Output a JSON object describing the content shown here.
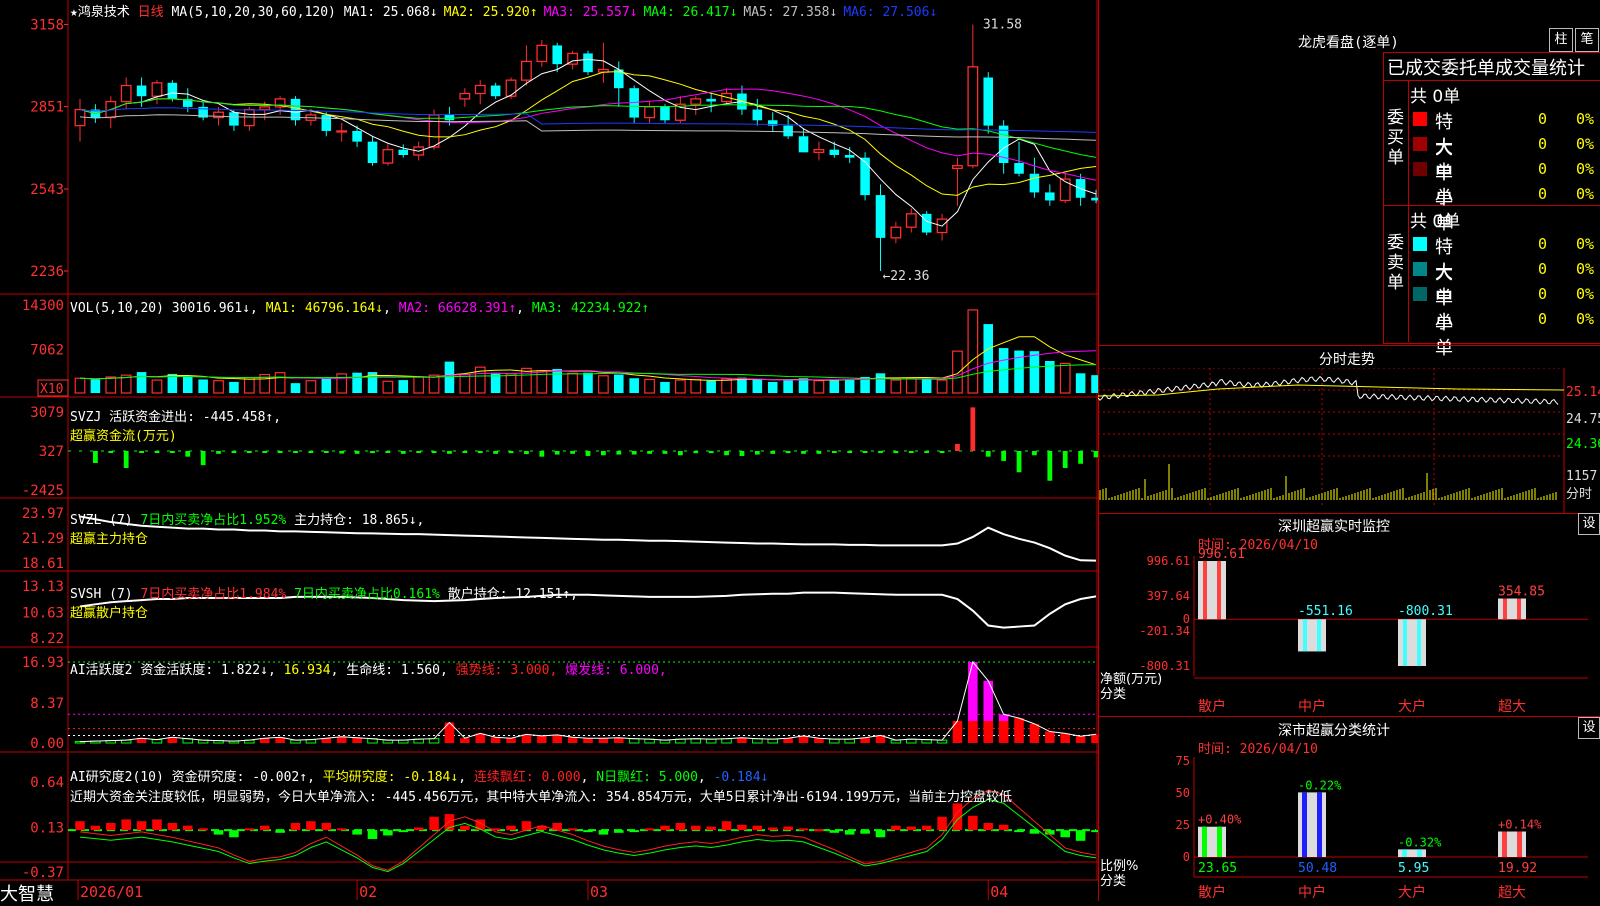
{
  "colors": {
    "up": "#ff2d2d",
    "down": "#00ffff",
    "ma1": "#ffffff",
    "ma2": "#ffff00",
    "ma3": "#ff00ff",
    "ma4": "#00ff00",
    "ma5": "#c0c0c0",
    "ma6": "#1a3cff",
    "grid": "#c00000",
    "axis": "#ff3030"
  },
  "app": {
    "logo": "大智慧"
  },
  "kline": {
    "stock_name": "鸿泉技术",
    "period": "日线",
    "ma_params": "MA(5,10,20,30,60,120)",
    "ma_labels": [
      {
        "text": "MA1: 25.068↓",
        "color": "#ffffff"
      },
      {
        "text": "MA2: 25.920↑",
        "color": "#ffff00"
      },
      {
        "text": "MA3: 25.557↓",
        "color": "#ff00ff"
      },
      {
        "text": "MA4: 26.417↓",
        "color": "#00ff00"
      },
      {
        "text": "MA5: 27.358↓",
        "color": "#c0c0c0"
      },
      {
        "text": "MA6: 27.506↓",
        "color": "#1a3cff"
      }
    ],
    "y_ticks": [
      "3158",
      "2851",
      "2543",
      "2236"
    ],
    "high_label": "31.58",
    "low_label": "←22.36",
    "candles": [
      [
        27.8,
        28.8,
        27.2,
        28.4
      ],
      [
        28.4,
        28.6,
        27.9,
        28.1
      ],
      [
        28.1,
        28.9,
        27.7,
        28.7
      ],
      [
        28.7,
        29.6,
        28.4,
        29.3
      ],
      [
        29.3,
        29.6,
        28.5,
        28.9
      ],
      [
        28.9,
        29.5,
        28.6,
        29.4
      ],
      [
        29.4,
        29.5,
        28.7,
        28.8
      ],
      [
        28.8,
        29.2,
        28.3,
        28.5
      ],
      [
        28.5,
        28.7,
        28.0,
        28.1
      ],
      [
        28.1,
        28.5,
        27.8,
        28.3
      ],
      [
        28.3,
        28.4,
        27.6,
        27.8
      ],
      [
        27.8,
        28.5,
        27.6,
        28.4
      ],
      [
        28.4,
        28.7,
        28.0,
        28.5
      ],
      [
        28.5,
        28.9,
        28.2,
        28.8
      ],
      [
        28.8,
        28.9,
        27.8,
        28.0
      ],
      [
        28.0,
        28.3,
        27.8,
        28.2
      ],
      [
        28.2,
        28.3,
        27.4,
        27.6
      ],
      [
        27.6,
        27.9,
        27.2,
        27.6
      ],
      [
        27.6,
        27.8,
        27.0,
        27.2
      ],
      [
        27.2,
        27.4,
        26.3,
        26.4
      ],
      [
        26.4,
        27.1,
        26.3,
        26.9
      ],
      [
        26.9,
        27.1,
        26.6,
        26.7
      ],
      [
        26.7,
        27.2,
        26.5,
        27.0
      ],
      [
        27.0,
        28.4,
        26.9,
        28.2
      ],
      [
        28.2,
        28.5,
        27.8,
        28.0
      ],
      [
        28.8,
        29.2,
        28.5,
        29.0
      ],
      [
        29.0,
        29.5,
        28.6,
        29.3
      ],
      [
        29.3,
        29.4,
        28.8,
        28.9
      ],
      [
        28.9,
        29.6,
        28.8,
        29.5
      ],
      [
        29.5,
        30.8,
        29.3,
        30.2
      ],
      [
        30.2,
        31.0,
        30.0,
        30.8
      ],
      [
        30.8,
        30.9,
        29.8,
        30.1
      ],
      [
        30.1,
        30.6,
        29.9,
        30.5
      ],
      [
        30.5,
        30.6,
        29.7,
        29.8
      ],
      [
        29.8,
        30.9,
        29.4,
        29.9
      ],
      [
        29.9,
        30.2,
        28.5,
        29.2
      ],
      [
        29.2,
        29.3,
        27.9,
        28.1
      ],
      [
        28.1,
        28.7,
        27.9,
        28.5
      ],
      [
        28.5,
        28.6,
        27.9,
        28.0
      ],
      [
        28.0,
        28.9,
        27.9,
        28.6
      ],
      [
        28.6,
        28.9,
        28.2,
        28.8
      ],
      [
        28.8,
        29.0,
        28.3,
        28.7
      ],
      [
        28.7,
        29.2,
        28.6,
        29.0
      ],
      [
        29.0,
        29.3,
        28.2,
        28.4
      ],
      [
        28.4,
        28.8,
        27.8,
        28.0
      ],
      [
        28.0,
        28.3,
        27.6,
        27.8
      ],
      [
        27.8,
        28.2,
        27.3,
        27.4
      ],
      [
        27.4,
        27.7,
        26.8,
        26.8
      ],
      [
        26.8,
        27.2,
        26.5,
        26.9
      ],
      [
        26.9,
        27.2,
        26.6,
        26.7
      ],
      [
        26.7,
        27.0,
        26.4,
        26.6
      ],
      [
        26.6,
        26.8,
        25.0,
        25.2
      ],
      [
        25.2,
        25.6,
        22.36,
        23.6
      ],
      [
        23.6,
        24.2,
        23.4,
        24.0
      ],
      [
        24.0,
        24.7,
        23.8,
        24.5
      ],
      [
        24.5,
        24.6,
        23.7,
        23.8
      ],
      [
        23.8,
        24.5,
        23.5,
        24.3
      ],
      [
        26.2,
        26.6,
        24.8,
        26.3
      ],
      [
        26.3,
        31.58,
        26.2,
        30.0
      ],
      [
        29.6,
        29.8,
        27.5,
        27.8
      ],
      [
        27.8,
        28.0,
        26.0,
        26.4
      ],
      [
        26.4,
        27.2,
        25.9,
        26.0
      ],
      [
        26.0,
        26.6,
        25.1,
        25.3
      ],
      [
        25.3,
        25.6,
        24.8,
        25.0
      ],
      [
        25.0,
        26.0,
        24.9,
        25.8
      ],
      [
        25.8,
        26.0,
        24.8,
        25.1
      ],
      [
        25.1,
        25.4,
        24.9,
        25.0
      ]
    ]
  },
  "vol": {
    "title": "VOL(5,10,20)",
    "value": "30016.961↓",
    "ma1": "MA1: 46796.164↓",
    "ma2": "MA2: 66628.391↑",
    "ma3": "MA3: 42234.922↑",
    "y_ticks": [
      "14300",
      "7062"
    ],
    "unit": "X10",
    "values": [
      2.4,
      2.2,
      2.6,
      2.9,
      3.4,
      2.1,
      3.1,
      2.7,
      2.2,
      2.0,
      1.8,
      2.5,
      3.0,
      3.3,
      1.6,
      2.0,
      2.5,
      3.1,
      3.3,
      3.4,
      1.9,
      2.1,
      2.6,
      2.9,
      5.1,
      3.0,
      4.2,
      3.3,
      3.1,
      4.0,
      3.6,
      3.9,
      3.2,
      3.3,
      2.8,
      3.0,
      2.4,
      2.2,
      1.8,
      2.1,
      2.2,
      2.0,
      2.3,
      2.5,
      2.2,
      1.8,
      2.1,
      2.4,
      2.0,
      2.2,
      2.2,
      2.6,
      3.2,
      2.1,
      2.4,
      2.3,
      2.1,
      6.8,
      13.5,
      11.2,
      7.3,
      6.9,
      6.8,
      5.2,
      4.8,
      3.2,
      2.9
    ]
  },
  "svzj": {
    "title": "SVZJ",
    "desc": "活跃资金进出: -445.458↑,",
    "sub": "超赢资金流(万元)",
    "y_ticks": [
      "3079",
      "327",
      "-2425"
    ],
    "values": [
      0,
      -850,
      -20,
      -1200,
      -40,
      -20,
      -90,
      -400,
      -1000,
      -200,
      -120,
      -100,
      -120,
      -20,
      -130,
      -80,
      -90,
      -180,
      -200,
      -150,
      -120,
      -200,
      -100,
      -120,
      -200,
      -130,
      -40,
      -200,
      -150,
      -220,
      -400,
      -250,
      -200,
      -350,
      -300,
      -250,
      -250,
      -200,
      -200,
      -300,
      -150,
      -150,
      -300,
      -350,
      -250,
      -200,
      -150,
      -200,
      -200,
      -120,
      -100,
      -120,
      -120,
      -150,
      -130,
      -80,
      -100,
      500,
      3079,
      -400,
      -700,
      -1500,
      -300,
      -2100,
      -1200,
      -900,
      -445
    ]
  },
  "svzl": {
    "title": "SVZL (7)",
    "desc1": "7日内买卖净占比1.952%",
    "desc2": "主力持仓: 18.865↓,",
    "sub": "超赢主力持仓",
    "y_ticks": [
      "23.97",
      "21.29",
      "18.61"
    ],
    "values": [
      23.6,
      23.3,
      23.0,
      22.8,
      22.6,
      22.5,
      22.4,
      22.3,
      22.3,
      22.2,
      22.2,
      22.1,
      22.1,
      22.0,
      22.0,
      21.95,
      21.9,
      21.85,
      21.8,
      21.78,
      21.75,
      21.7,
      21.7,
      21.65,
      21.6,
      21.55,
      21.5,
      21.45,
      21.4,
      21.35,
      21.3,
      21.25,
      21.2,
      21.15,
      21.1,
      21.1,
      21.05,
      21.0,
      21.0,
      20.95,
      20.9,
      20.85,
      20.8,
      20.75,
      20.7,
      20.7,
      20.65,
      20.6,
      20.6,
      20.6,
      20.55,
      20.55,
      20.5,
      20.5,
      20.5,
      20.5,
      20.5,
      20.7,
      21.4,
      22.4,
      21.7,
      21.2,
      20.8,
      20.2,
      19.4,
      18.9,
      18.86
    ]
  },
  "svsh": {
    "title": "SVSH (7)",
    "desc1": "7日内买卖净占比1.984%",
    "desc2": "7日内买卖净占比0.161%",
    "desc3": "散户持仓: 12.151↑,",
    "sub": "超赢散户持仓",
    "y_ticks": [
      "13.13",
      "10.63",
      "8.22"
    ],
    "values": [
      11.2,
      11.4,
      11.6,
      11.7,
      11.8,
      11.9,
      11.9,
      12.0,
      12.0,
      12.0,
      12.0,
      12.0,
      12.0,
      12.0,
      12.1,
      12.1,
      12.1,
      12.1,
      12.05,
      12.0,
      11.9,
      11.8,
      11.75,
      11.7,
      11.75,
      11.8,
      11.9,
      12.0,
      12.05,
      12.1,
      12.2,
      12.3,
      12.3,
      12.3,
      12.25,
      12.2,
      12.15,
      12.1,
      12.1,
      12.1,
      12.1,
      12.15,
      12.2,
      12.3,
      12.35,
      12.4,
      12.4,
      12.5,
      12.5,
      12.5,
      12.45,
      12.4,
      12.35,
      12.3,
      12.3,
      12.3,
      12.3,
      11.9,
      10.8,
      9.4,
      9.2,
      9.3,
      9.4,
      10.5,
      11.4,
      11.9,
      12.15
    ]
  },
  "ai": {
    "title": "AI活跃度2",
    "desc1": "资金活跃度: 1.822↓",
    "desc2": "16.934",
    "desc3": "生命线: 1.560,",
    "desc4": "强势线: 3.000,",
    "desc5": "爆发线: 6.000,",
    "y_ticks": [
      "16.93",
      "8.37",
      "0.00"
    ],
    "values": [
      0.3,
      0.4,
      0.5,
      0.6,
      1.0,
      0.7,
      1.2,
      0.9,
      0.6,
      0.5,
      0.4,
      0.6,
      1.0,
      1.2,
      0.6,
      0.7,
      1.0,
      1.3,
      1.1,
      0.9,
      0.6,
      0.6,
      0.8,
      0.9,
      4.3,
      1.0,
      2.0,
      1.2,
      1.0,
      1.8,
      1.5,
      1.7,
      1.2,
      1.0,
      1.0,
      1.1,
      0.9,
      0.8,
      0.6,
      0.8,
      0.9,
      0.8,
      0.9,
      1.1,
      0.9,
      0.8,
      1.0,
      1.5,
      1.0,
      0.8,
      0.8,
      1.1,
      1.6,
      0.6,
      0.8,
      0.7,
      0.6,
      4.6,
      16.93,
      13.0,
      6.0,
      5.2,
      4.0,
      2.4,
      2.0,
      1.4,
      1.822
    ]
  },
  "ai2": {
    "title": "AI研究度2(10)",
    "desc1": "资金研究度: -0.002↑",
    "desc2": "平均研究度: -0.184↓",
    "desc3": "连续飘红: 0.000",
    "desc4": "N日飘红: 5.000",
    "desc5": "-0.184↓",
    "note": "近期大资金关注度较低，明显弱势，今日大单净流入: -445.456万元，其中特大单净流入: 354.854万元，大单5日累计净出-6194.199万元，当前主力控盘较低",
    "y_ticks": [
      "0.64",
      "0.13",
      "-0.37"
    ],
    "values": [
      0.1,
      0.05,
      0.08,
      0.12,
      0.1,
      0.12,
      0.08,
      0.05,
      0.02,
      -0.05,
      -0.08,
      0.02,
      0.05,
      -0.03,
      0.08,
      0.1,
      0.08,
      0.02,
      -0.05,
      -0.1,
      -0.06,
      -0.02,
      0.03,
      0.15,
      0.18,
      0.05,
      0.12,
      0.02,
      0.05,
      0.1,
      0.05,
      0.08,
      0.02,
      -0.02,
      -0.05,
      -0.03,
      -0.02,
      0.02,
      0.05,
      0.08,
      0.05,
      0.04,
      0.1,
      0.06,
      0.05,
      0.03,
      0.04,
      0.02,
      0.01,
      -0.03,
      -0.05,
      -0.04,
      -0.08,
      0.05,
      0.04,
      0.05,
      0.15,
      0.3,
      0.16,
      0.08,
      0.06,
      -0.02,
      -0.04,
      -0.05,
      -0.08,
      -0.12,
      -0.002
    ],
    "line": [
      0.08,
      0.06,
      0.04,
      0.06,
      0.08,
      0.05,
      0.02,
      -0.02,
      -0.06,
      -0.1,
      -0.18,
      -0.25,
      -0.22,
      -0.2,
      -0.15,
      -0.05,
      0.02,
      -0.08,
      -0.18,
      -0.3,
      -0.35,
      -0.25,
      -0.1,
      0.05,
      0.2,
      0.25,
      0.18,
      0.08,
      0.05,
      0.1,
      0.15,
      0.1,
      0.05,
      -0.02,
      -0.08,
      -0.12,
      -0.15,
      -0.12,
      -0.08,
      -0.05,
      -0.03,
      -0.05,
      -0.02,
      0.02,
      0.05,
      0.03,
      0.04,
      0.02,
      -0.05,
      -0.12,
      -0.2,
      -0.28,
      -0.25,
      -0.2,
      -0.15,
      -0.1,
      0.05,
      0.3,
      0.45,
      0.55,
      0.5,
      0.35,
      0.2,
      0.05,
      -0.1,
      -0.15,
      -0.18
    ]
  },
  "timeline_x": [
    "2026/01",
    "02",
    "03",
    "04"
  ],
  "side": {
    "lhb_title": "龙虎看盘(逐单)",
    "btn1": "柱",
    "btn2": "笔",
    "tabs": [
      "已成交委托",
      "单成交量统计"
    ],
    "buy_label": [
      "委",
      "买",
      "单"
    ],
    "sell_label": [
      "委",
      "卖",
      "单"
    ],
    "buy_total": "共 0单",
    "sell_total": "共 0单",
    "buy_rows": [
      {
        "label": "特大",
        "count": "0",
        "pct": "0%",
        "color": "#ff0000"
      },
      {
        "label": "大单",
        "count": "0",
        "pct": "0%",
        "color": "#a00000"
      },
      {
        "label": "中单",
        "count": "0",
        "pct": "0%",
        "color": "#700000"
      },
      {
        "label": "小单",
        "count": "0",
        "pct": "0%",
        "color": ""
      }
    ],
    "sell_rows": [
      {
        "label": "特大",
        "count": "0",
        "pct": "0%",
        "color": "#00ffff"
      },
      {
        "label": "大单",
        "count": "0",
        "pct": "0%",
        "color": "#008888"
      },
      {
        "label": "中单",
        "count": "0",
        "pct": "0%",
        "color": "#006666"
      },
      {
        "label": "小单",
        "count": "0",
        "pct": "0%",
        "color": ""
      }
    ],
    "fs_title": "分时走势",
    "fs_ticks": [
      "25.14",
      "24.75",
      "24.36",
      "1157"
    ],
    "fs_unit": "分时",
    "sz_title": "深圳超赢实时监控",
    "sz_set": "设",
    "sz_time": "时间: 2026/04/10",
    "sz_ticks": [
      "996.61",
      "397.64",
      "0",
      "-201.34",
      "-800.31"
    ],
    "sz_unit": "净额(万元)",
    "sz_cat": "分类",
    "sz_bars": [
      {
        "label": "散户",
        "value": 996.61,
        "text": "996.61",
        "color": "#ff4040"
      },
      {
        "label": "中户",
        "value": -551.16,
        "text": "-551.16",
        "color": "#40ffff"
      },
      {
        "label": "大户",
        "value": -800.31,
        "text": "-800.31",
        "color": "#40ffff"
      },
      {
        "label": "超大",
        "value": 354.85,
        "text": "354.85",
        "color": "#ff4040"
      }
    ],
    "ss_title": "深市超赢分类统计",
    "ss_set": "设",
    "ss_time": "时间: 2026/04/10",
    "ss_ticks": [
      "75",
      "50",
      "25",
      "0"
    ],
    "ss_unit": "比例%",
    "ss_cat": "分类",
    "ss_bars": [
      {
        "label": "散户",
        "value": 23.65,
        "text": "23.65",
        "delta": "+0.40%",
        "dcolor": "#ff4040",
        "fill": "#00ff00"
      },
      {
        "label": "中户",
        "value": 50.48,
        "text": "50.48",
        "delta": "-0.22%",
        "dcolor": "#00ff00",
        "fill": "#2020ff"
      },
      {
        "label": "大户",
        "value": 5.95,
        "text": "5.95",
        "delta": "-0.32%",
        "dcolor": "#00ff00",
        "fill": "#40ffff"
      },
      {
        "label": "超大",
        "value": 19.92,
        "text": "19.92",
        "delta": "+0.14%",
        "dcolor": "#ff4040",
        "fill": "#ff4040"
      }
    ]
  }
}
